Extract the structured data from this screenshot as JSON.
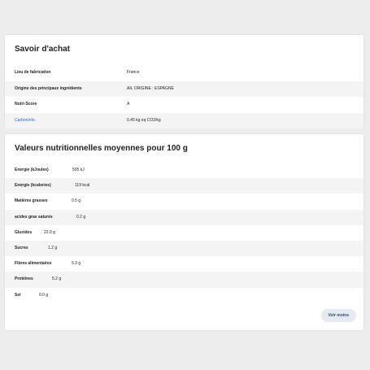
{
  "achat": {
    "title": "Savoir d'achat",
    "rows": [
      {
        "label": "Lieu de fabrication",
        "value": "France"
      },
      {
        "label": "Origine des principaux ingrédients",
        "value": "AIL ORIGINE : ESPAGNE"
      },
      {
        "label": "Nutri-Score",
        "value": "A"
      },
      {
        "label": "CarbonInfo",
        "value": "0.45 kg eq CO2/kg"
      }
    ]
  },
  "nutrition": {
    "title": "Valeurs nutritionnelles moyennes pour 100 g",
    "rows": [
      {
        "label": "Energie (kJoules)",
        "value": "505 kJ"
      },
      {
        "label": "Energie (kcalories)",
        "value": "119 kcal"
      },
      {
        "label": "Matières grasses",
        "value": "0.5 g"
      },
      {
        "label": "acides gras saturés",
        "value": "0.2 g"
      },
      {
        "label": "Glucides",
        "value": "22.0 g"
      },
      {
        "label": "Sucres",
        "value": "1.2 g"
      },
      {
        "label": "Fibres alimentaires",
        "value": "5.3 g"
      },
      {
        "label": "Protéines",
        "value": "5.2 g"
      },
      {
        "label": "Sel",
        "value": "0.0 g"
      }
    ],
    "more_label": "Voir moins"
  },
  "colors": {
    "link": "#1a73c9",
    "button_bg": "#e6ebf1",
    "stripe": "#f4f4f4"
  }
}
